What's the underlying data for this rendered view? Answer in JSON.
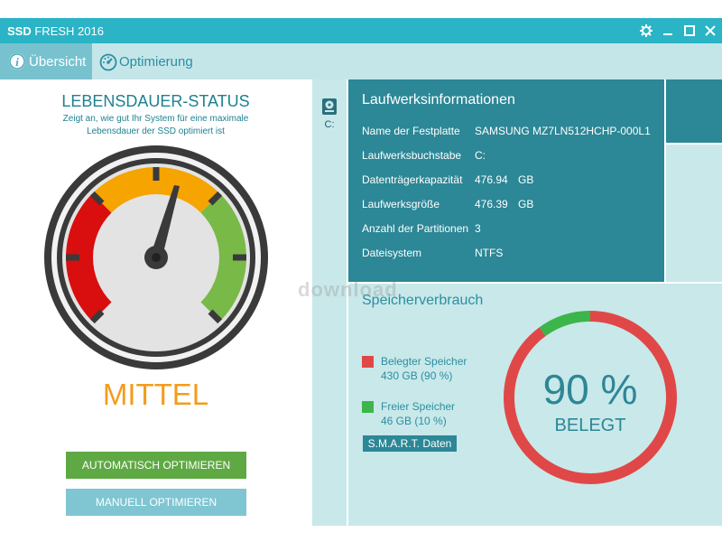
{
  "titlebar": {
    "app_bold": "SSD",
    "app_rest": "FRESH 2016",
    "buttons": [
      "settings-icon",
      "minimize-icon",
      "maximize-icon",
      "close-icon"
    ]
  },
  "tabs": [
    {
      "label": "Übersicht",
      "icon": "info-icon",
      "active": true
    },
    {
      "label": "Optimierung",
      "icon": "speedometer-icon",
      "active": false
    }
  ],
  "status": {
    "title": "LEBENSDAUER-STATUS",
    "subtitle": "Zeigt an, wie gut Ihr System für eine maximale Lebensdauer der SSD optimiert ist",
    "level": "MITTEL",
    "auto_button": "AUTOMATISCH OPTIMIEREN",
    "manual_button": "MANUELL OPTIMIEREN"
  },
  "drive": {
    "label": "C:"
  },
  "info": {
    "title": "Laufwerksinformationen",
    "rows": [
      {
        "key": "Name der Festplatte",
        "value": "SAMSUNG MZ7LN512HCHP-000L1",
        "unit": ""
      },
      {
        "key": "Laufwerksbuchstabe",
        "value": "C:",
        "unit": ""
      },
      {
        "key": "Datenträgerkapazität",
        "value": "476.94",
        "unit": "GB"
      },
      {
        "key": "Laufwerksgröße",
        "value": "476.39",
        "unit": "GB"
      },
      {
        "key": "Anzahl der Partitionen",
        "value": "3",
        "unit": ""
      },
      {
        "key": "Dateisystem",
        "value": "NTFS",
        "unit": ""
      }
    ]
  },
  "usage": {
    "title": "Speicherverbrauch",
    "used_label": "Belegter Speicher",
    "used_value": "430 GB (90 %)",
    "free_label": "Freier Speicher",
    "free_value": "46 GB (10 %)",
    "smart_button": "S.M.A.R.T. Daten",
    "percent": "90 %",
    "percent_caption": "BELEGT",
    "used_fraction": 0.9,
    "colors": {
      "used": "#e04848",
      "free": "#3cb54a"
    }
  },
  "watermark": "download"
}
